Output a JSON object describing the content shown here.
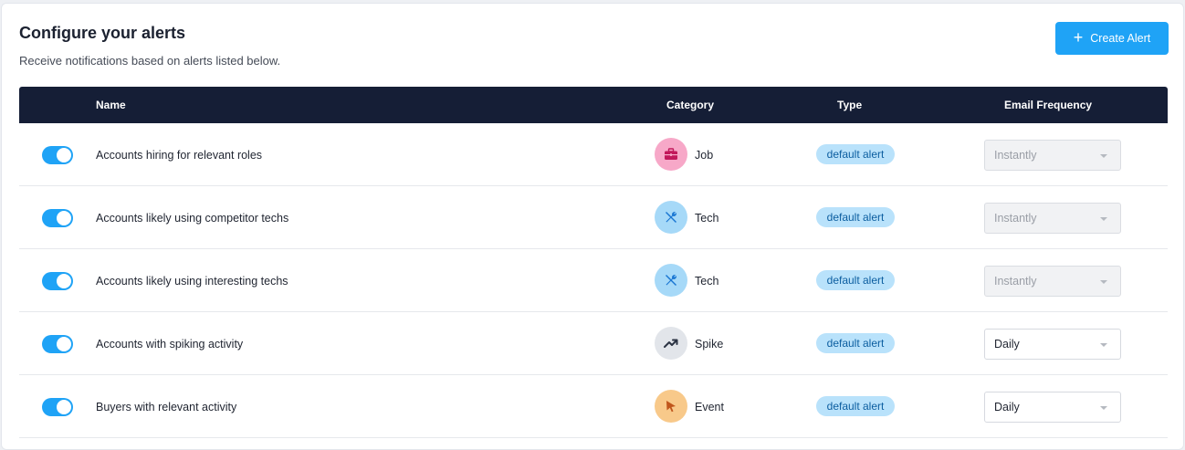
{
  "header": {
    "title": "Configure your alerts",
    "subtitle": "Receive notifications based on alerts listed below.",
    "create_button": "Create Alert"
  },
  "table": {
    "columns": [
      "Name",
      "Category",
      "Type",
      "Email Frequency"
    ],
    "rows": [
      {
        "enabled": true,
        "name": "Accounts hiring for relevant roles",
        "category": "Job",
        "category_icon": "briefcase-icon",
        "icon_bg": "#f7a8c8",
        "icon_color": "#c2185b",
        "type": "default alert",
        "frequency": "Instantly",
        "frequency_disabled": true
      },
      {
        "enabled": true,
        "name": "Accounts likely using competitor techs",
        "category": "Tech",
        "category_icon": "tools-icon",
        "icon_bg": "#a6d9f8",
        "icon_color": "#1976d2",
        "type": "default alert",
        "frequency": "Instantly",
        "frequency_disabled": true
      },
      {
        "enabled": true,
        "name": "Accounts likely using interesting techs",
        "category": "Tech",
        "category_icon": "tools-icon",
        "icon_bg": "#a6d9f8",
        "icon_color": "#1976d2",
        "type": "default alert",
        "frequency": "Instantly",
        "frequency_disabled": true
      },
      {
        "enabled": true,
        "name": "Accounts with spiking activity",
        "category": "Spike",
        "category_icon": "trending-up-icon",
        "icon_bg": "#e2e5ea",
        "icon_color": "#2c3444",
        "type": "default alert",
        "frequency": "Daily",
        "frequency_disabled": false
      },
      {
        "enabled": true,
        "name": "Buyers with relevant activity",
        "category": "Event",
        "category_icon": "cursor-icon",
        "icon_bg": "#f8c98a",
        "icon_color": "#c0561c",
        "type": "default alert",
        "frequency": "Daily",
        "frequency_disabled": false
      }
    ]
  },
  "colors": {
    "accent": "#1fa3f6",
    "header_bg": "#151e36",
    "badge_bg": "#b9e2fb"
  }
}
